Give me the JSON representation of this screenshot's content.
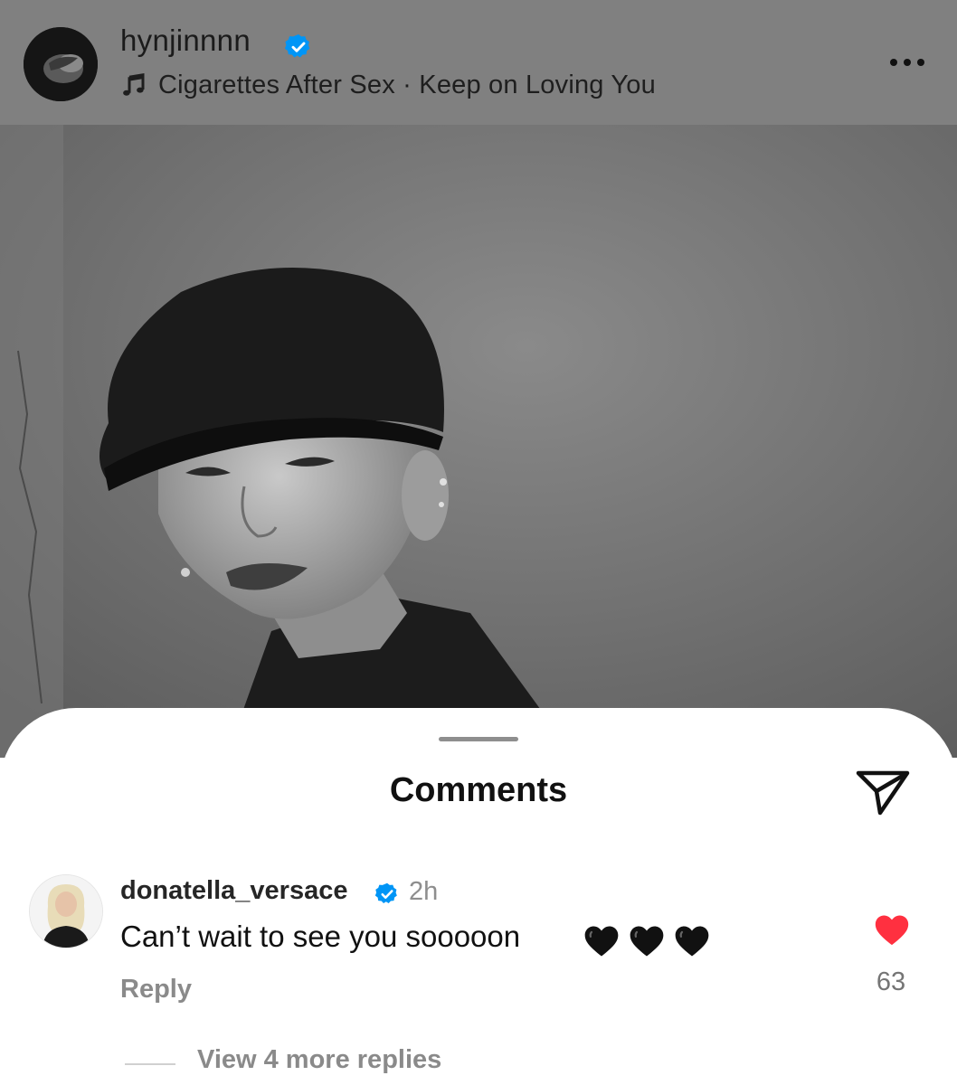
{
  "post": {
    "username": "hynjinnnn",
    "music": "Cigarettes After Sex · Keep on Loving You"
  },
  "comments_sheet": {
    "title": "Comments",
    "comment": {
      "username": "donatella_versace",
      "time": "2h",
      "text": "Can’t wait to see you sooooon",
      "emoji": "🖤🖤🖤",
      "likes": "63",
      "reply_label": "Reply",
      "view_replies_label": "View 4 more replies"
    }
  },
  "colors": {
    "header_bg": "#808080",
    "verified_blue": "#0095f6",
    "like_red": "#ff3040",
    "muted_text": "#8a8a8a"
  },
  "icons": [
    "music-note-icon",
    "verified-badge-icon",
    "more-options-icon",
    "share-icon",
    "heart-icon"
  ]
}
